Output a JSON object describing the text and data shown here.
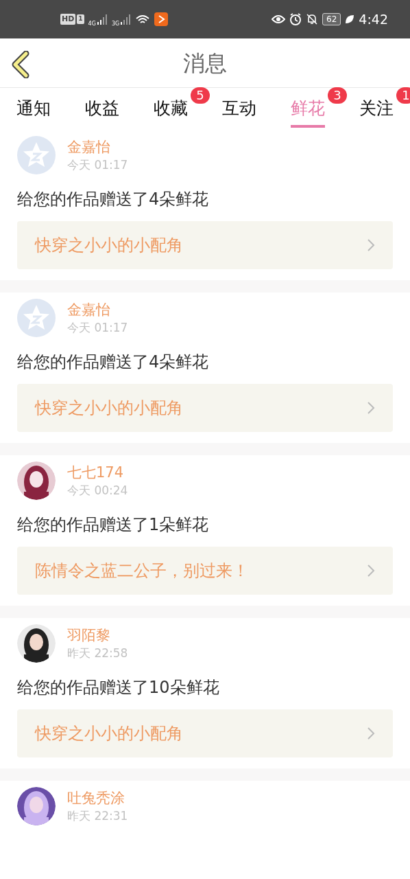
{
  "status_bar": {
    "hd": "HD",
    "sim": "1",
    "net1": "4G",
    "net2": "3G",
    "battery": "62",
    "time": "4:42"
  },
  "header": {
    "title": "消息"
  },
  "tabs": [
    {
      "label": "通知",
      "selected": false
    },
    {
      "label": "收益",
      "selected": false
    },
    {
      "label": "收藏",
      "selected": false,
      "badge": "5"
    },
    {
      "label": "互动",
      "selected": false
    },
    {
      "label": "鲜花",
      "selected": true,
      "badge": "3"
    },
    {
      "label": "关注",
      "selected": false,
      "badge": "1"
    }
  ],
  "messages": [
    {
      "avatar": {
        "kind": "default"
      },
      "name": "金嘉怡",
      "time": "今天 01:17",
      "text": "给您的作品赠送了4朵鲜花",
      "book": "快穿之小小的小配角"
    },
    {
      "avatar": {
        "kind": "default"
      },
      "name": "金嘉怡",
      "time": "今天 01:17",
      "text": "给您的作品赠送了4朵鲜花",
      "book": "快穿之小小的小配角"
    },
    {
      "name": "七七174",
      "time": "今天 00:24",
      "text": "给您的作品赠送了1朵鲜花",
      "book": "陈情令之蓝二公子，别过来！"
    },
    {
      "name": "羽陌黎",
      "time": "昨天 22:58",
      "text": "给您的作品赠送了10朵鲜花",
      "book": "快穿之小小的小配角"
    },
    {
      "name": "吐兔秃涂",
      "time": "昨天 22:31"
    }
  ]
}
